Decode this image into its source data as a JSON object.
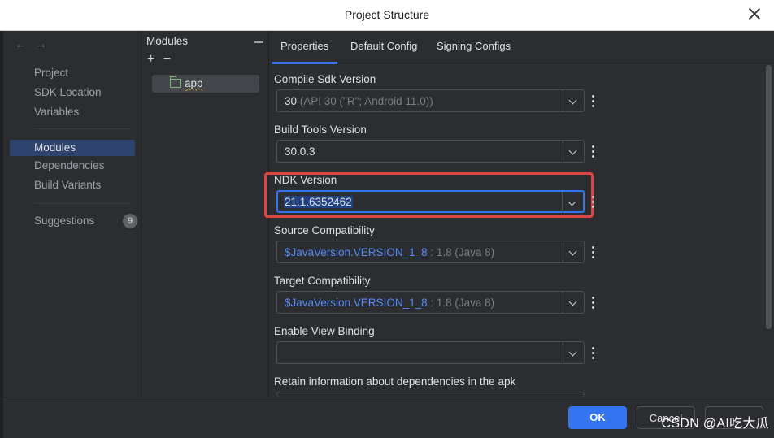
{
  "window": {
    "title": "Project Structure"
  },
  "nav": {
    "items": [
      {
        "label": "Project"
      },
      {
        "label": "SDK Location"
      },
      {
        "label": "Variables"
      },
      {
        "label": "Modules",
        "selected": true
      },
      {
        "label": "Dependencies"
      },
      {
        "label": "Build Variants"
      },
      {
        "label": "Suggestions",
        "badge": "9"
      }
    ]
  },
  "modules": {
    "header": "Modules",
    "add": "+",
    "remove": "−",
    "items": [
      {
        "label": "app"
      }
    ]
  },
  "tabs": [
    {
      "label": "Properties",
      "active": true
    },
    {
      "label": "Default Config"
    },
    {
      "label": "Signing Configs"
    }
  ],
  "properties": {
    "compile_sdk": {
      "label": "Compile Sdk Version",
      "value": "30",
      "hint": " (API 30 (\"R\"; Android 11.0))"
    },
    "build_tools": {
      "label": "Build Tools Version",
      "value": "30.0.3"
    },
    "ndk": {
      "label": "NDK Version",
      "value": "21.1.6352462"
    },
    "source_compat": {
      "label": "Source Compatibility",
      "link": "$JavaVersion.VERSION_1_8",
      "hint": " : 1.8 (Java 8)"
    },
    "target_compat": {
      "label": "Target Compatibility",
      "link": "$JavaVersion.VERSION_1_8",
      "hint": " : 1.8 (Java 8)"
    },
    "view_binding": {
      "label": "Enable View Binding",
      "value": ""
    },
    "retain_info": {
      "label": "Retain information about dependencies in the apk"
    }
  },
  "footer": {
    "ok": "OK",
    "cancel": "Cancel",
    "watermark": "CSDN @AI吃大瓜"
  },
  "colors": {
    "accent": "#3574f0",
    "highlight": "#e04343",
    "link": "#548af7"
  }
}
